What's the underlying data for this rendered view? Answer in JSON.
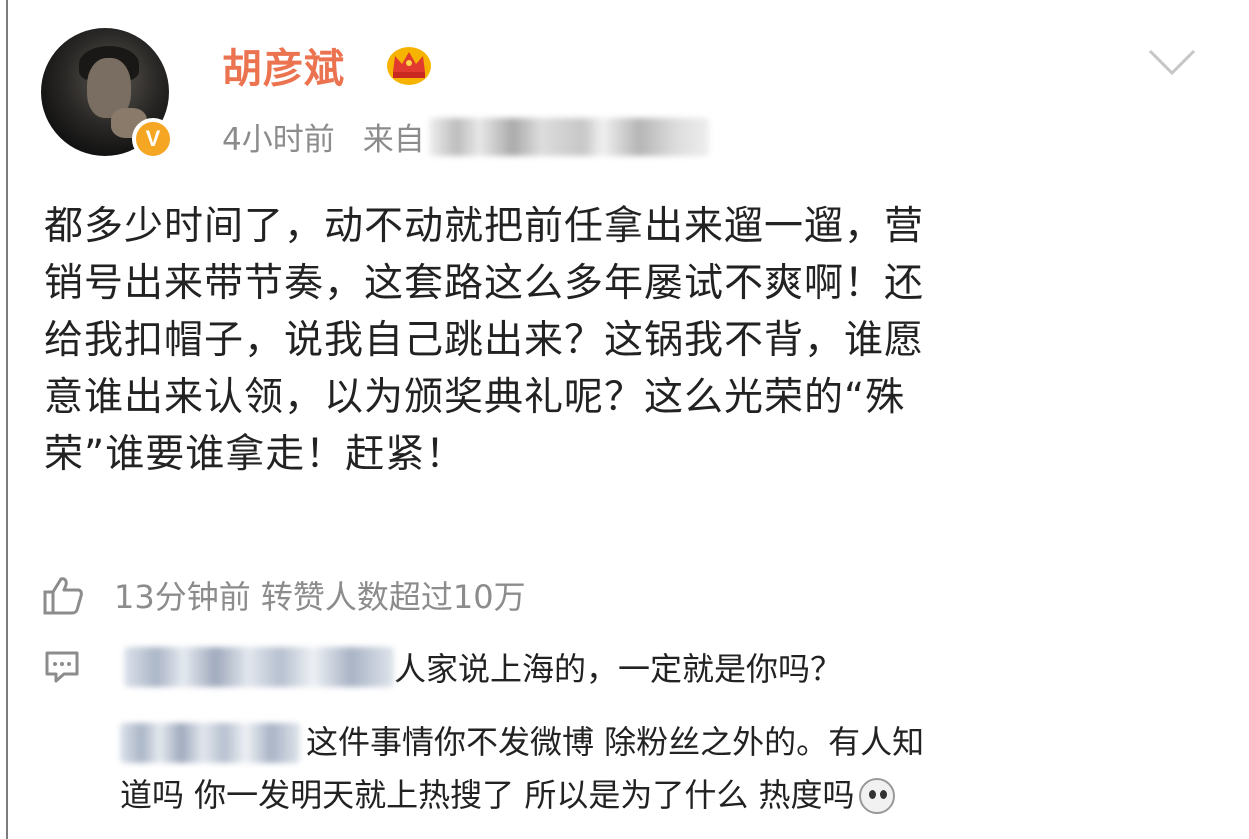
{
  "post": {
    "author": "胡彦斌",
    "time": "4小时前",
    "source_prefix": "来自",
    "lines": [
      "都多少时间了，动不动就把前任拿出来遛一遛，营",
      "销号出来带节奏，这套路这么多年屡试不爽啊！还",
      "给我扣帽子，说我自己跳出来？这锅我不背，谁愿",
      "意谁出来认领，以为颁奖典礼呢？这么光荣的“殊",
      "荣”谁要谁拿走！赶紧！"
    ],
    "like_text": "13分钟前 转赞人数超过10万"
  },
  "comments": [
    {
      "text": "人家说上海的，一定就是你吗？"
    },
    {
      "line1": "这件事情你不发微博 除粉丝之外的。有人知",
      "line2": "道吗 你一发明天就上热搜了 所以是为了什么 热度吗"
    }
  ],
  "icons": {
    "crown": "crown-icon",
    "verified": "verified-badge-icon",
    "chevron": "chevron-down-icon",
    "like": "thumbs-up-icon",
    "comment": "comment-icon",
    "emoji": "emoji-icon"
  },
  "colors": {
    "username": "#eb7350",
    "meta": "#8c8c8c",
    "verified": "#f5a623"
  }
}
